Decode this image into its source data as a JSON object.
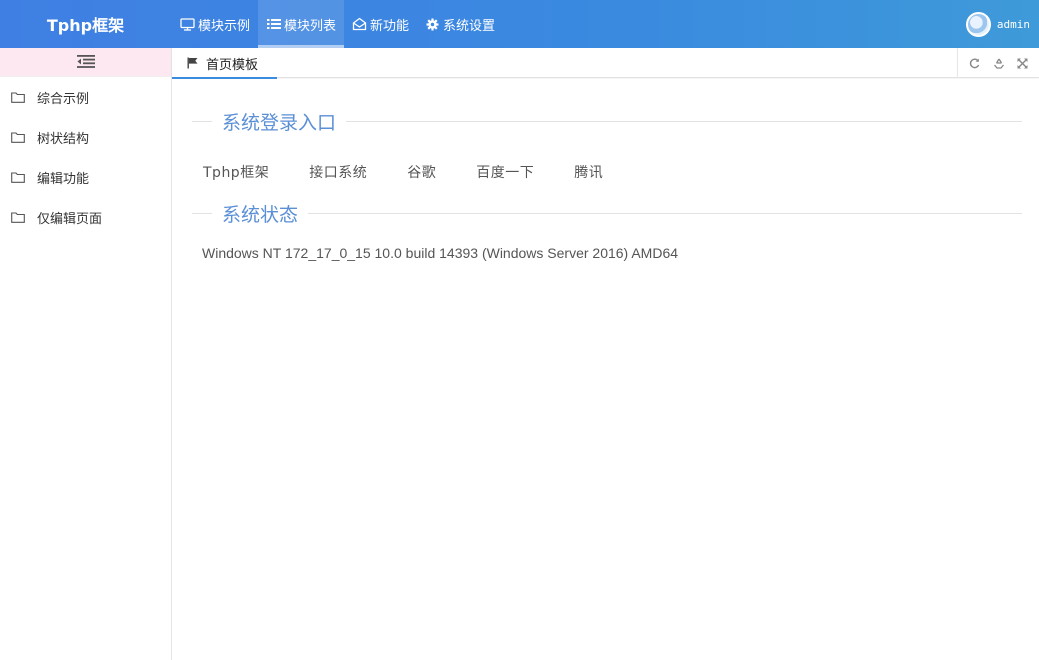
{
  "app": {
    "logo": "Tphp框架"
  },
  "nav": {
    "items": [
      {
        "label": "模块示例",
        "icon": "monitor-icon"
      },
      {
        "label": "模块列表",
        "icon": "list-icon"
      },
      {
        "label": "新功能",
        "icon": "envelope-open-icon"
      },
      {
        "label": "系统设置",
        "icon": "gear-icon"
      }
    ],
    "active_index": 1
  },
  "user": {
    "name": "admin"
  },
  "sidebar": {
    "items": [
      {
        "label": "综合示例",
        "icon": "folder-icon"
      },
      {
        "label": "树状结构",
        "icon": "folder-icon"
      },
      {
        "label": "编辑功能",
        "icon": "folder-icon"
      },
      {
        "label": "仅编辑页面",
        "icon": "folder-icon"
      }
    ]
  },
  "tabs": [
    {
      "label": "首页模板",
      "icon": "flag-icon"
    }
  ],
  "tab_tools": [
    "refresh-icon",
    "recycle-icon",
    "fullscreen-icon"
  ],
  "main": {
    "login_section_title": "系统登录入口",
    "links": [
      "Tphp框架",
      "接口系统",
      "谷歌",
      "百度一下",
      "腾讯"
    ],
    "status_section_title": "系统状态",
    "system_info": "Windows NT 172_17_0_15 10.0 build 14393 (Windows Server 2016) AMD64"
  }
}
